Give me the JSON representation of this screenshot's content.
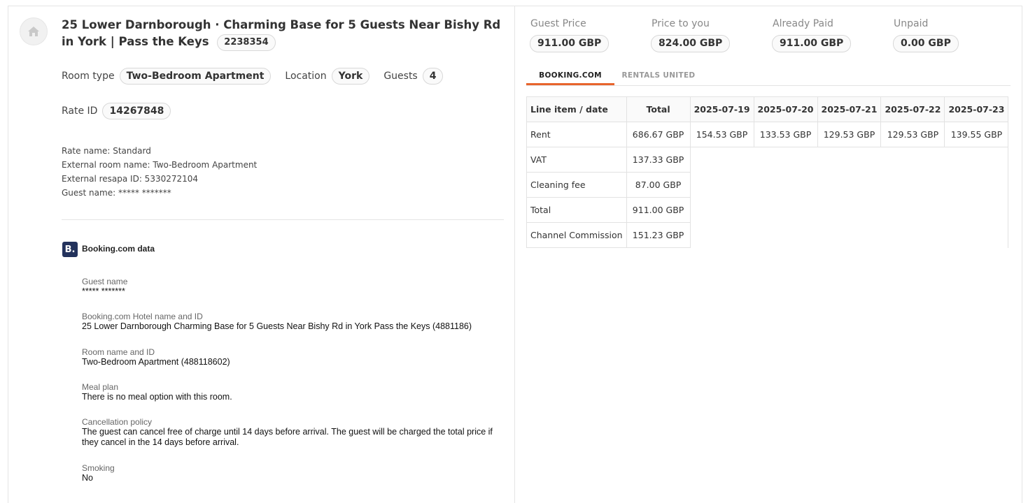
{
  "listing": {
    "title": "25 Lower Darnborough · Charming Base for 5 Guests Near Bishy Rd in York | Pass the Keys",
    "id": "2238354",
    "room_type_label": "Room type",
    "room_type": "Two-Bedroom Apartment",
    "location_label": "Location",
    "location": "York",
    "guests_label": "Guests",
    "guests": "4",
    "rate_id_label": "Rate ID",
    "rate_id": "14267848",
    "meta": [
      "Rate name: Standard",
      "External room name: Two-Bedroom Apartment",
      "External resapa ID: 5330272104",
      "Guest name: ***** *******"
    ]
  },
  "booking_data": {
    "logo_letter": "B.",
    "title": "Booking.com data",
    "fields": [
      {
        "label": "Guest name",
        "value": "***** *******"
      },
      {
        "label": "Booking.com Hotel name and ID",
        "value": "25 Lower Darnborough Charming Base for 5 Guests Near Bishy Rd in York Pass the Keys (4881186)"
      },
      {
        "label": "Room name and ID",
        "value": "Two-Bedroom Apartment (488118602)"
      },
      {
        "label": "Meal plan",
        "value": "There is no meal option with this room."
      },
      {
        "label": "Cancellation policy",
        "value": "The guest can cancel free of charge until 14 days before arrival. The guest will be charged the total price if they cancel in the 14 days before arrival."
      },
      {
        "label": "Smoking",
        "value": "No"
      }
    ]
  },
  "prices": [
    {
      "label": "Guest Price",
      "value": "911.00 GBP"
    },
    {
      "label": "Price to you",
      "value": "824.00 GBP"
    },
    {
      "label": "Already Paid",
      "value": "911.00 GBP"
    },
    {
      "label": "Unpaid",
      "value": "0.00 GBP"
    }
  ],
  "tabs": [
    {
      "label": "BOOKING.COM",
      "active": true
    },
    {
      "label": "RENTALS UNITED",
      "active": false
    }
  ],
  "table": {
    "headers": [
      "Line item / date",
      "Total",
      "2025-07-19",
      "2025-07-20",
      "2025-07-21",
      "2025-07-22",
      "2025-07-23"
    ],
    "rows": [
      {
        "label": "Rent",
        "total": "686.67 GBP",
        "days": [
          "154.53 GBP",
          "133.53 GBP",
          "129.53 GBP",
          "129.53 GBP",
          "139.55 GBP"
        ]
      },
      {
        "label": "VAT",
        "total": "137.33 GBP"
      },
      {
        "label": "Cleaning fee",
        "total": "87.00 GBP"
      },
      {
        "label": "Total",
        "total": "911.00 GBP"
      },
      {
        "label": "Channel Commission",
        "total": "151.23 GBP"
      }
    ]
  },
  "colors": {
    "accent": "#e8642c",
    "booking_brand": "#23325c"
  },
  "icons": [
    "home-icon"
  ]
}
